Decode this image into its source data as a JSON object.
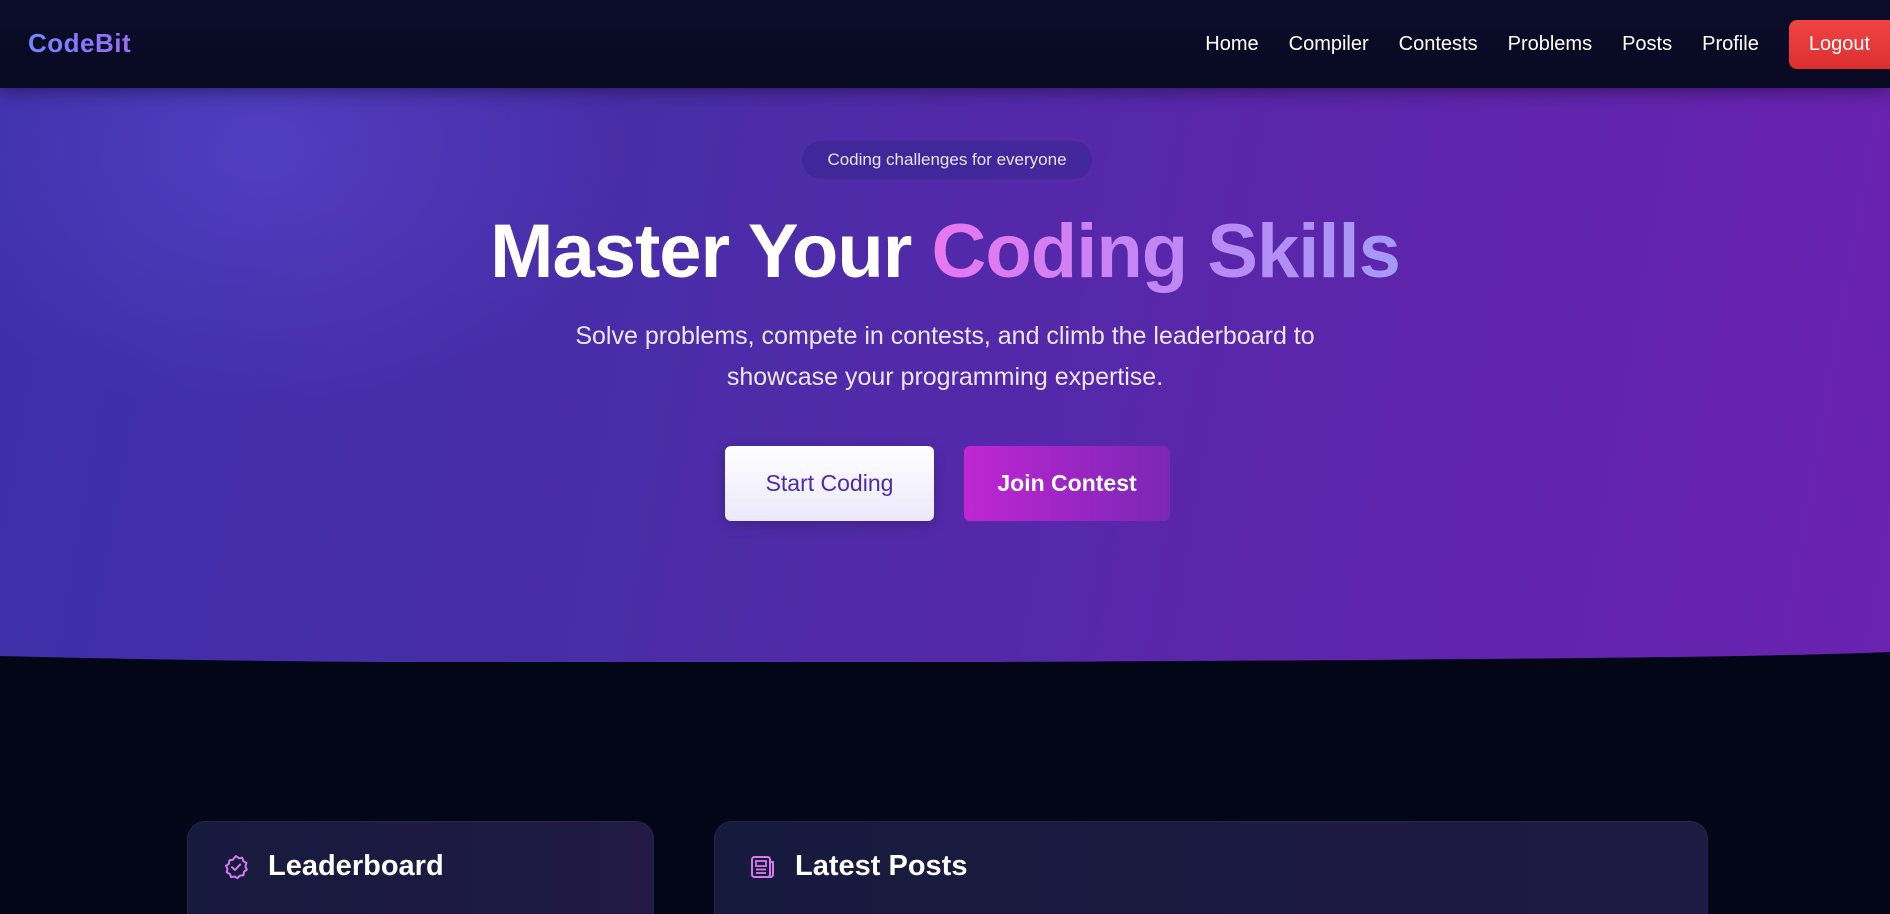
{
  "navbar": {
    "brand": "CodeBit",
    "links": [
      "Home",
      "Compiler",
      "Contests",
      "Problems",
      "Posts",
      "Profile"
    ],
    "logout_label": "Logout"
  },
  "hero": {
    "badge": "Coding challenges for everyone",
    "title_main": "Master Your ",
    "title_accent": "Coding Skills",
    "subtitle": "Solve problems, compete in contests, and climb the leaderboard to showcase your programming expertise.",
    "start_label": "Start Coding",
    "join_label": "Join Contest"
  },
  "cards": {
    "leaderboard_title": "Leaderboard",
    "posts_title": "Latest Posts"
  },
  "icons": {
    "leaderboard": "badge-check-icon",
    "posts": "newspaper-icon"
  },
  "colors": {
    "background": "#030616",
    "navbar": "#0b0d2a",
    "logout": "#ef4444",
    "hero_start": "#3d2fa8",
    "hero_end": "#6a22b0",
    "accent_pink": "#e877f0",
    "join_button": "#c026d3"
  }
}
